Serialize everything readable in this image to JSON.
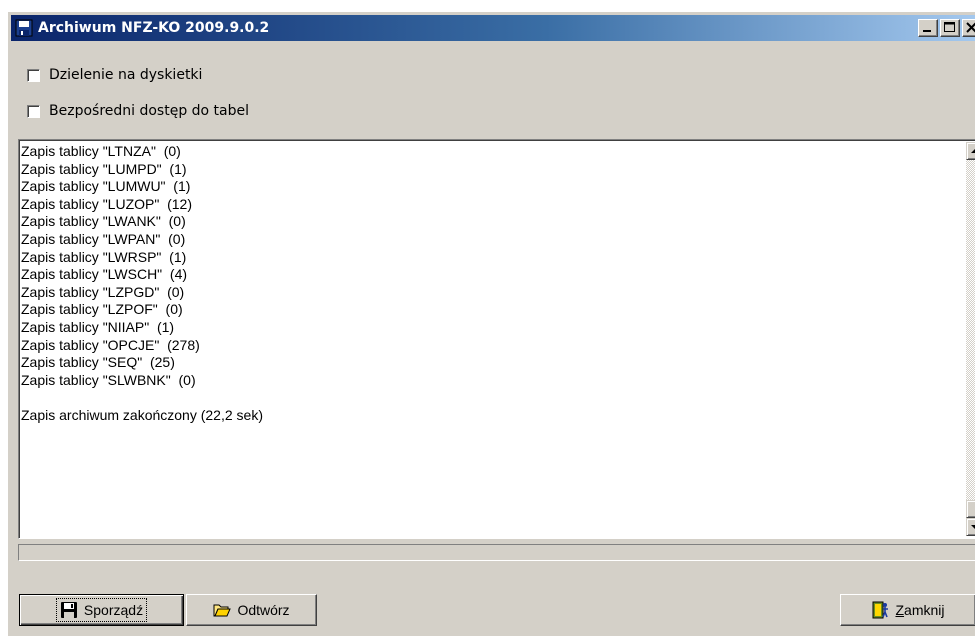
{
  "window": {
    "title": "Archiwum NFZ-KO 2009.9.0.2",
    "buttons": [
      "minimize",
      "maximize",
      "close"
    ]
  },
  "options": {
    "split_disks_label": "Dzielenie na dyskietki",
    "direct_access_label": "Bezpośredni dostęp do tabel",
    "split_disks_checked": false,
    "direct_access_checked": false
  },
  "log": {
    "lines": [
      "Zapis tablicy \"LTNZA\"  (0)",
      "Zapis tablicy \"LUMPD\"  (1)",
      "Zapis tablicy \"LUMWU\"  (1)",
      "Zapis tablicy \"LUZOP\"  (12)",
      "Zapis tablicy \"LWANK\"  (0)",
      "Zapis tablicy \"LWPAN\"  (0)",
      "Zapis tablicy \"LWRSP\"  (1)",
      "Zapis tablicy \"LWSCH\"  (4)",
      "Zapis tablicy \"LZPGD\"  (0)",
      "Zapis tablicy \"LZPOF\"  (0)",
      "Zapis tablicy \"NIIAP\"  (1)",
      "Zapis tablicy \"OPCJE\"  (278)",
      "Zapis tablicy \"SEQ\"  (25)",
      "Zapis tablicy \"SLWBNK\"  (0)",
      "",
      "Zapis archiwum zakończony (22,2 sek)"
    ]
  },
  "buttons": {
    "create_label": "Sporządź",
    "restore_label": "Odtwórz",
    "close_label": "Zamknij"
  },
  "icons": {
    "app": "floppy-disk-icon",
    "create": "floppy-disk-icon",
    "restore": "open-folder-icon",
    "close": "exit-door-icon"
  },
  "colors": {
    "title_start": "#0a246a",
    "title_end": "#a6caf0",
    "face": "#d4d0c8"
  }
}
